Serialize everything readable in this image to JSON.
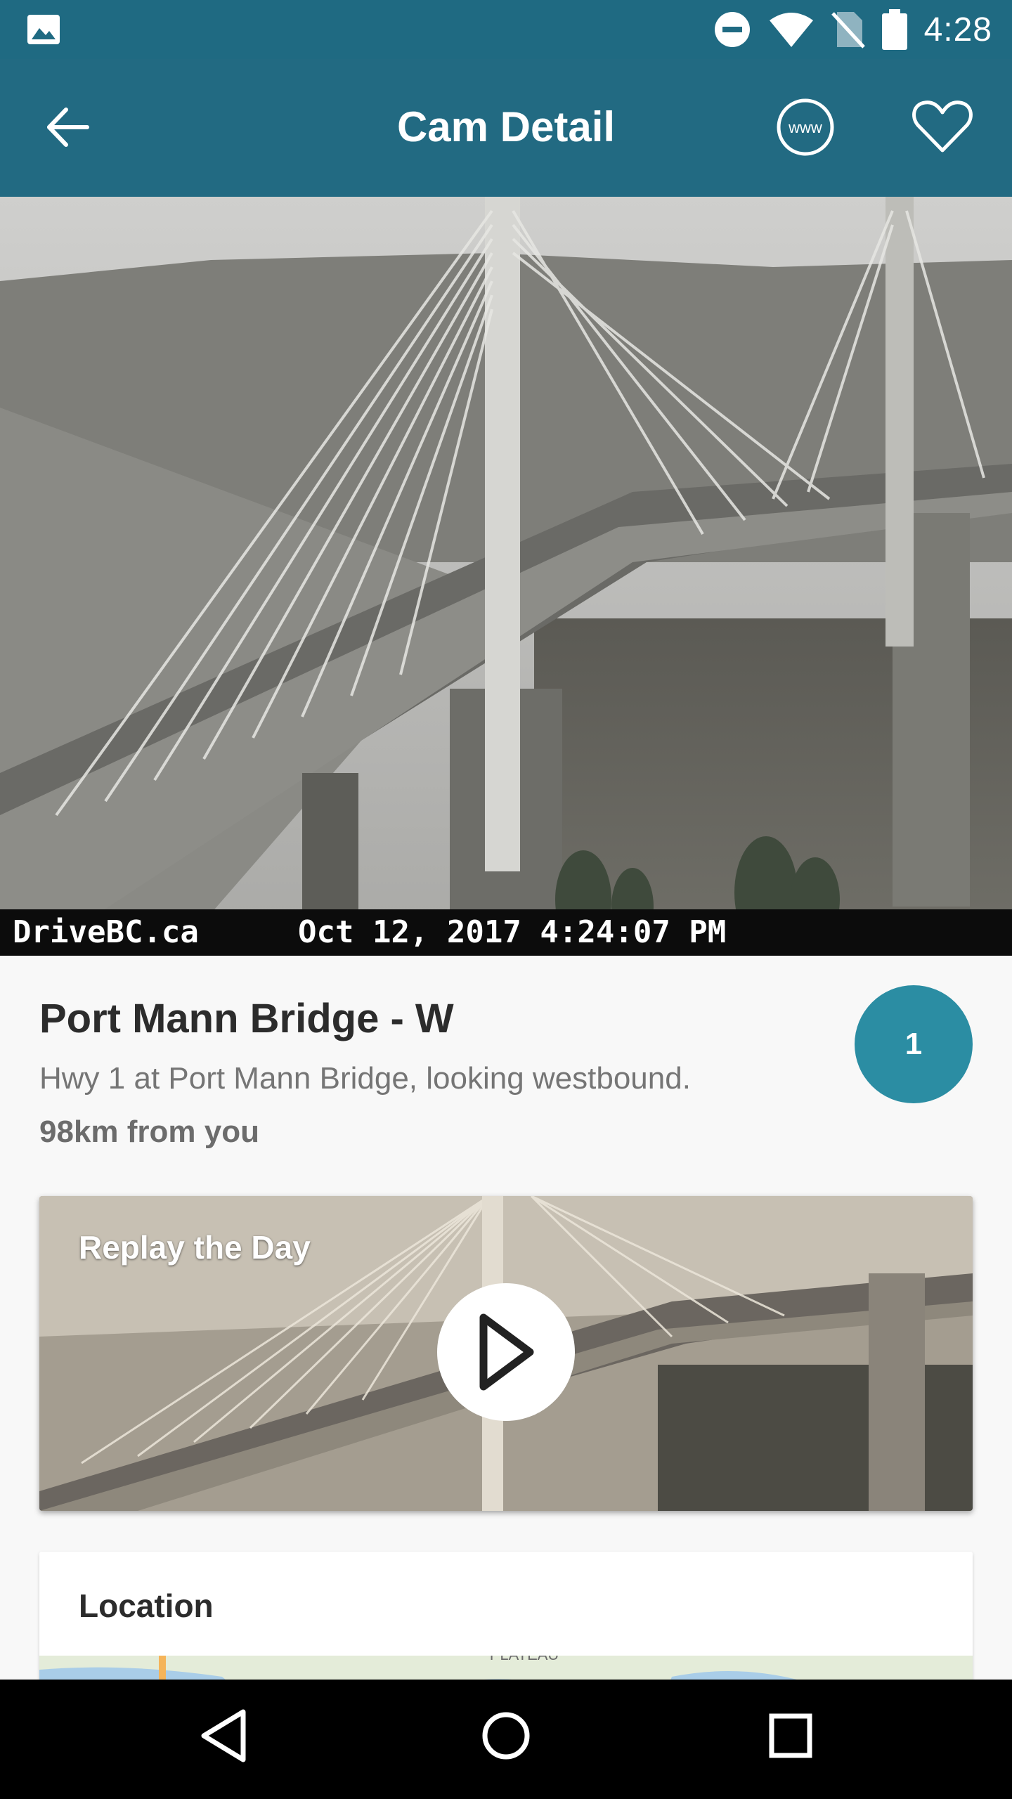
{
  "status": {
    "time": "4:28",
    "left_icon": "image-icon",
    "right_icons": [
      "do-not-disturb-icon",
      "wifi-icon",
      "no-sim-icon",
      "battery-icon"
    ]
  },
  "app_bar": {
    "title": "Cam Detail",
    "back_icon": "arrow-back-icon",
    "www_label": "www",
    "favorite_icon": "heart-outline-icon"
  },
  "camera": {
    "caption_site": "DriveBC.ca",
    "caption_timestamp": "Oct 12, 2017 4:24:07 PM",
    "name": "Port Mann Bridge - W",
    "description": "Hwy 1 at Port Mann Bridge, looking westbound.",
    "distance": "98km from you",
    "badge": "1"
  },
  "replay": {
    "label": "Replay the Day",
    "play_icon": "play-icon"
  },
  "location": {
    "title": "Location",
    "map_label": "PLATEAU"
  },
  "nav": {
    "back_icon": "nav-back-icon",
    "home_icon": "nav-home-icon",
    "recents_icon": "nav-recents-icon"
  },
  "colors": {
    "app_bar": "#226a82",
    "badge": "#2b8da3",
    "background": "#f8f8f8"
  }
}
